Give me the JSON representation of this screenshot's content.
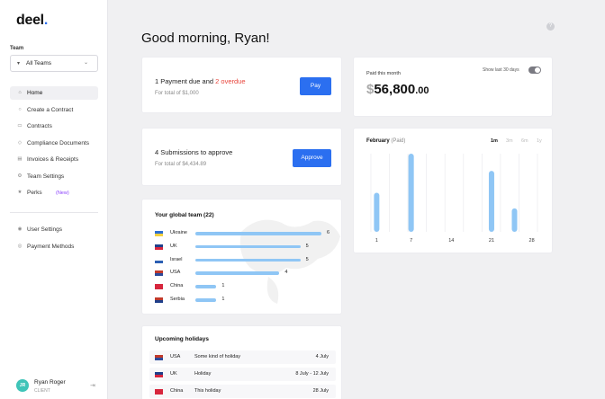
{
  "sidebar": {
    "logo": "deel",
    "logo_dot": ".",
    "team_label": "Team",
    "team_select": "All Teams",
    "nav": [
      {
        "label": "Home",
        "icon": "⌂",
        "active": true
      },
      {
        "label": "Create a Contract",
        "icon": "○"
      },
      {
        "label": "Contracts",
        "icon": "▭"
      },
      {
        "label": "Compliance Documents",
        "icon": "◇"
      },
      {
        "label": "Invoices & Receipts",
        "icon": "▤"
      },
      {
        "label": "Team Settings",
        "icon": "⚙"
      },
      {
        "label": "Perks",
        "icon": "★",
        "badge": "(New)"
      }
    ],
    "nav_bottom": [
      {
        "label": "User Settings",
        "icon": "◉"
      },
      {
        "label": "Payment Methods",
        "icon": "◎"
      }
    ],
    "user": {
      "initials": "JR",
      "name": "Ryan Roger",
      "role": "CLIENT"
    }
  },
  "header": {
    "greeting": "Good morning, Ryan!",
    "help_icon": "?"
  },
  "payments": {
    "title_prefix": "1 Payment due and ",
    "title_overdue": "2 overdue",
    "subtitle": "For total of $1,000",
    "button": "Pay"
  },
  "submissions": {
    "title": "4 Submissions to approve",
    "subtitle": "For total of $4,434.89",
    "button": "Approve"
  },
  "global_team": {
    "title": "Your global team (22)",
    "rows": [
      {
        "country": "Ukraine",
        "count": 6,
        "flag": [
          "#2d6fd1",
          "#f4d03f"
        ]
      },
      {
        "country": "UK",
        "count": 5,
        "flag": [
          "#1f3f8a",
          "#d7263d"
        ]
      },
      {
        "country": "Israel",
        "count": 5,
        "flag": [
          "#ffffff",
          "#2b5fb3"
        ]
      },
      {
        "country": "USA",
        "count": 4,
        "flag": [
          "#c0392b",
          "#2c4a9a"
        ]
      },
      {
        "country": "China",
        "count": 1,
        "flag": [
          "#d7263d",
          "#d7263d"
        ]
      },
      {
        "country": "Serbia",
        "count": 1,
        "flag": [
          "#c0392b",
          "#1f3f8a"
        ]
      }
    ]
  },
  "holidays": {
    "title": "Upcoming holidays",
    "rows": [
      {
        "country": "USA",
        "name": "Some kind of holiday",
        "date": "4 July",
        "flag": [
          "#c0392b",
          "#2c4a9a"
        ]
      },
      {
        "country": "UK",
        "name": "Holiday",
        "date": "8 July - 12 July",
        "flag": [
          "#1f3f8a",
          "#d7263d"
        ]
      },
      {
        "country": "China",
        "name": "This holiday",
        "date": "28 July",
        "flag": [
          "#d7263d",
          "#d7263d"
        ]
      }
    ]
  },
  "paid_month": {
    "label": "Paid this month",
    "toggle_label": "Show last 30 days",
    "currency": "$",
    "amount": "56,800",
    "cents": ".00"
  },
  "chart_data": {
    "type": "bar",
    "title": "February",
    "subtitle": "(Paid)",
    "ranges": [
      "1m",
      "3m",
      "6m",
      "1y"
    ],
    "active_range": "1m",
    "x_ticks": [
      "1",
      "7",
      "14",
      "21",
      "28"
    ],
    "bars": [
      {
        "x": 1,
        "value": 0.5
      },
      {
        "x": 7,
        "value": 1.0
      },
      {
        "x": 21,
        "value": 0.78
      },
      {
        "x": 25,
        "value": 0.3
      }
    ],
    "x_range": [
      0,
      29
    ],
    "bar_color": "#8fc6f5"
  }
}
